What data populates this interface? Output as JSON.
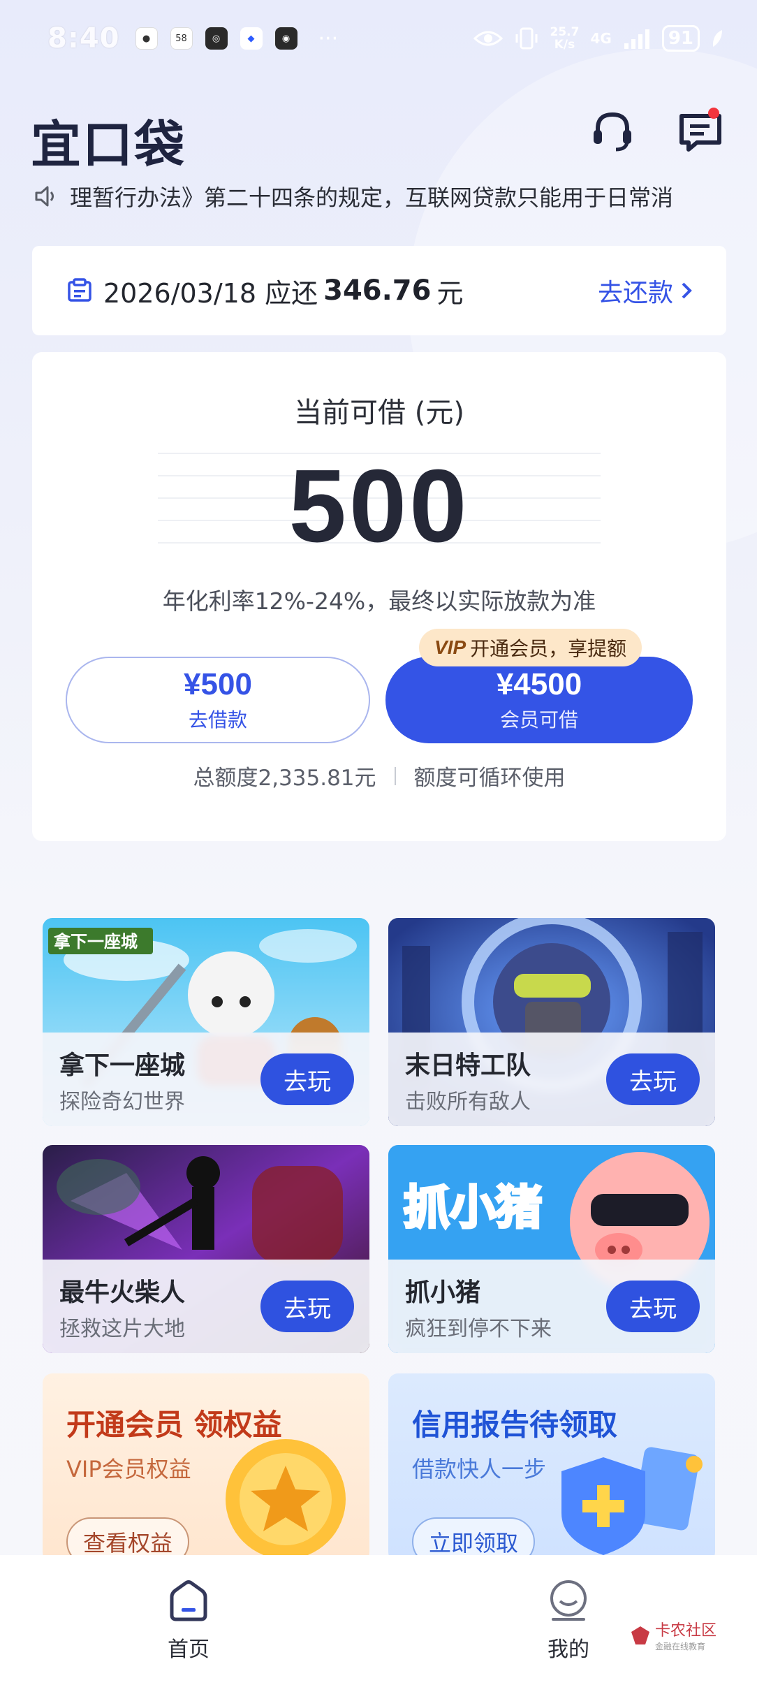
{
  "status_bar": {
    "time": "8:40",
    "app_icons": [
      "app-1",
      "58",
      "app-3",
      "app-4",
      "app-5"
    ],
    "more": "···",
    "speed_top": "25.7",
    "speed_bottom": "K/s",
    "network": "4G",
    "battery": "91"
  },
  "header": {
    "logo": "宜口袋",
    "support_icon": "headset-icon",
    "message_icon": "message-icon"
  },
  "notice": {
    "text": "理暂行办法》第二十四条的规定，互联网贷款只能用于日常消"
  },
  "repay": {
    "text": "2026/03/18 应还",
    "amount": "346.76",
    "unit": "元",
    "link": "去还款"
  },
  "credit": {
    "title": "当前可借 (元)",
    "amount": "500",
    "rate": "年化利率12%-24%，最终以实际放款为准",
    "vip_tag_brand": "VIP",
    "vip_tag": "开通会员，享提额",
    "borrow_amount": "¥500",
    "borrow_label": "去借款",
    "vip_amount": "¥4500",
    "vip_label": "会员可借",
    "total": "总额度2,335.81元",
    "cycle": "额度可循环使用"
  },
  "games": [
    {
      "title": "拿下一座城",
      "subtitle": "探险奇幻世界",
      "button": "去玩",
      "art_label": "拿下一座城"
    },
    {
      "title": "末日特工队",
      "subtitle": "击败所有敌人",
      "button": "去玩"
    },
    {
      "title": "最牛火柴人",
      "subtitle": "拯救这片大地",
      "button": "去玩"
    },
    {
      "title": "抓小猪",
      "subtitle": "疯狂到停不下来",
      "button": "去玩",
      "art_label": "抓小猪"
    }
  ],
  "promos": {
    "vip": {
      "title": "开通会员 领权益",
      "subtitle": "VIP会员权益",
      "button": "查看权益"
    },
    "credit": {
      "title": "信用报告待领取",
      "subtitle": "借款快人一步",
      "button": "立即领取"
    }
  },
  "bottom_nav": {
    "home": "首页",
    "mine": "我的"
  },
  "watermark": {
    "text": "卡农社区",
    "sub": "金融在线教育"
  },
  "colors": {
    "primary": "#3454e6",
    "text": "#22252e",
    "vip_tag_bg": "#fde7c9",
    "notice_red": "#f2353d"
  }
}
